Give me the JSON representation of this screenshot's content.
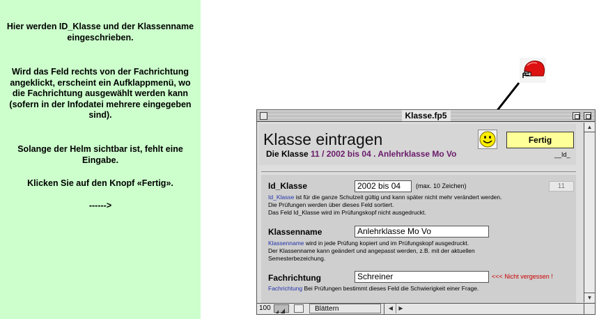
{
  "help": {
    "para1": "Hier werden ID_Klasse und der Klassenname eingeschrieben.",
    "para2": "Wird das Feld rechts von der Fachrichtung angeklickt, erscheint ein Aufklappmenü, wo die Fachrichtung ausgewählt werden kann (sofern in der Infodatei mehrere eingegeben sind).",
    "para3": "Solange der Helm sichtbar ist, fehlt eine Eingabe.",
    "para4": "Klicken Sie auf den Knopf «Fertig».",
    "arrow": "------>"
  },
  "window": {
    "title": "Klasse.fp5",
    "layout_title": "Klasse eintragen",
    "done_label": "Fertig",
    "class_summary_label": "Die Klasse",
    "class_summary_value": "11 / 2002 bis 04 . Anlehrklasse Mo Vo",
    "id_marker": "__Id_"
  },
  "fields": {
    "id_klasse": {
      "label": "Id_Klasse",
      "value": "2002 bis 04",
      "note": "(max. 10 Zeichen)",
      "counter": "11",
      "help_link": "Id_Klasse",
      "help_line1": " ist für die ganze Schulzeit gültig und kann später nicht mehr verändert werden.",
      "help_line2": "Die Prüfungen werden über dieses Feld sortiert.",
      "help_line3": "Das Feld Id_Klasse wird im Prüfungskopf nicht ausgedruckt."
    },
    "klassenname": {
      "label": "Klassenname",
      "value": "Anlehrklasse Mo Vo",
      "help_link": "Klassenname",
      "help_line1": " wird in jede Prüfung kopiert und im Prüfungskopf ausgedruckt.",
      "help_line2": "Der Klassenname kann geändert und angepasst werden, z.B. mit der aktuellen",
      "help_line3": "Semesterbezeichung."
    },
    "fachrichtung": {
      "label": "Fachrichtung",
      "value": "Schreiner",
      "required_note": "<<< Nicht vergessen !",
      "help_link": "Fachrichtung",
      "help_line1": " Bei Prüfungen bestimmt dieses Feld die Schwierigkeit einer Frage."
    }
  },
  "statusbar": {
    "zoom": "100",
    "mode": "Blättern"
  },
  "icons": {
    "helmet": "helmet-icon",
    "smiley": "smiley-icon"
  },
  "colors": {
    "help_bg": "#ccffcc",
    "done_button": "#ffff99",
    "required": "#cc0000",
    "summary_value": "#6a1a6a",
    "help_link": "#2233aa"
  }
}
